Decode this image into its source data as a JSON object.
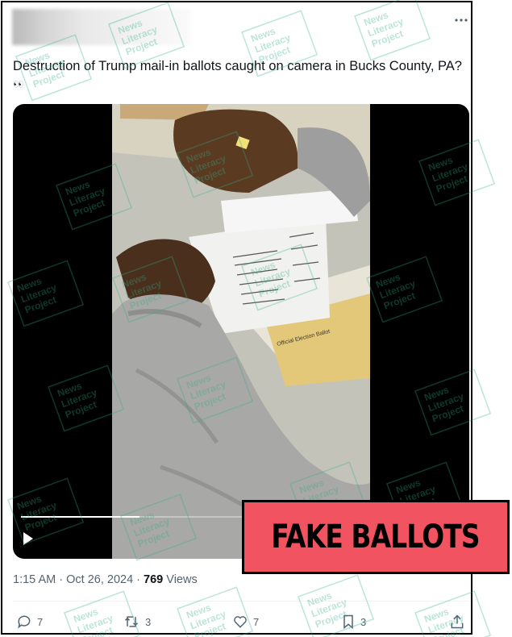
{
  "tweet": {
    "text": "Destruction of Trump mail-in ballots caught on camera in Bucks County, PA?",
    "emoji": "👀",
    "time": "1:15 AM",
    "date": "Oct 26, 2024",
    "views_count": "769",
    "views_label": "Views"
  },
  "video": {
    "progress": 0.27,
    "envelope_text": "Official Election Ballot"
  },
  "actions": {
    "replies": "7",
    "reposts": "3",
    "likes": "7",
    "bookmarks": "3"
  },
  "badge": {
    "label": "FAKE BALLOTS"
  },
  "watermark": {
    "line1": "News",
    "line2": "Literacy",
    "line3": "Project",
    "color": "#2fae8a"
  },
  "colors": {
    "badge": "#f25360",
    "meta": "#536471",
    "text": "#0f1419"
  },
  "icons": [
    "more-icon",
    "play-icon",
    "reply-icon",
    "repost-icon",
    "like-icon",
    "bookmark-icon",
    "share-icon"
  ]
}
